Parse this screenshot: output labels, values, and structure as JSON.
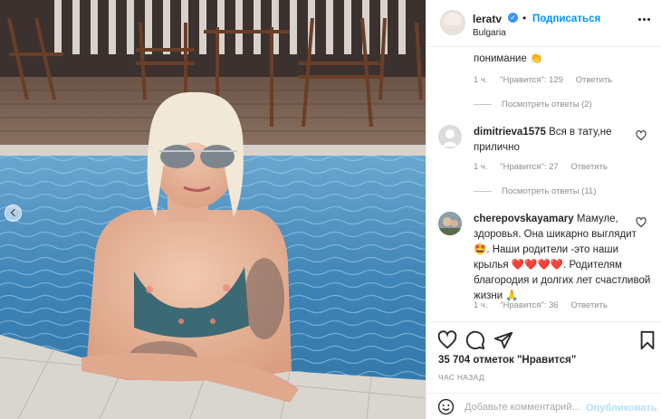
{
  "post": {
    "username": "leratv",
    "follow_label": "Подписаться",
    "location": "Bulgaria",
    "more_icon": "more-horizontal-icon",
    "verified_icon": "verified-badge-icon"
  },
  "comments": [
    {
      "text": "понимание",
      "emoji": "👏",
      "time": "1 ч.",
      "likes_text": "\"Нравится\": 129",
      "reply_label": "Ответить",
      "view_replies": "Посмотреть ответы (2)"
    },
    {
      "username": "dimitrieva1575",
      "text": "Вся в тату,не прилично",
      "time": "1 ч.",
      "likes_text": "\"Нравится\": 27",
      "reply_label": "Ответить",
      "view_replies": "Посмотреть ответы (11)"
    },
    {
      "username": "cherepovskayamary",
      "text_lines": [
        "Мамуле,",
        "здоровья. Она шикарно",
        "выглядит",
        "Наши родители",
        "-это наши крылья",
        "Родителям благородия и долгих",
        "лет счастливой жизни"
      ],
      "emoji_star_eyes": "🤩",
      "emoji_hearts": "❤️❤️❤️❤️",
      "emoji_pray": "🙏",
      "time": "1 ч.",
      "likes_text": "\"Нравится\": 36",
      "reply_label": "Ответить"
    }
  ],
  "actions": {
    "like_icon": "heart-icon",
    "comment_icon": "comment-icon",
    "share_icon": "share-icon",
    "save_icon": "bookmark-icon",
    "likes_text": "35 704 отметок \"Нравится\"",
    "time_ago": "ЧАС НАЗАД"
  },
  "add_comment": {
    "placeholder": "Добавьте комментарий...",
    "publish_label": "Опубликовать",
    "emoji_icon": "smiley-icon"
  },
  "colors": {
    "accent": "#0095f6",
    "verified": "#3897f0",
    "muted": "#8e8e8e",
    "publish_disabled": "#b2dffc"
  }
}
